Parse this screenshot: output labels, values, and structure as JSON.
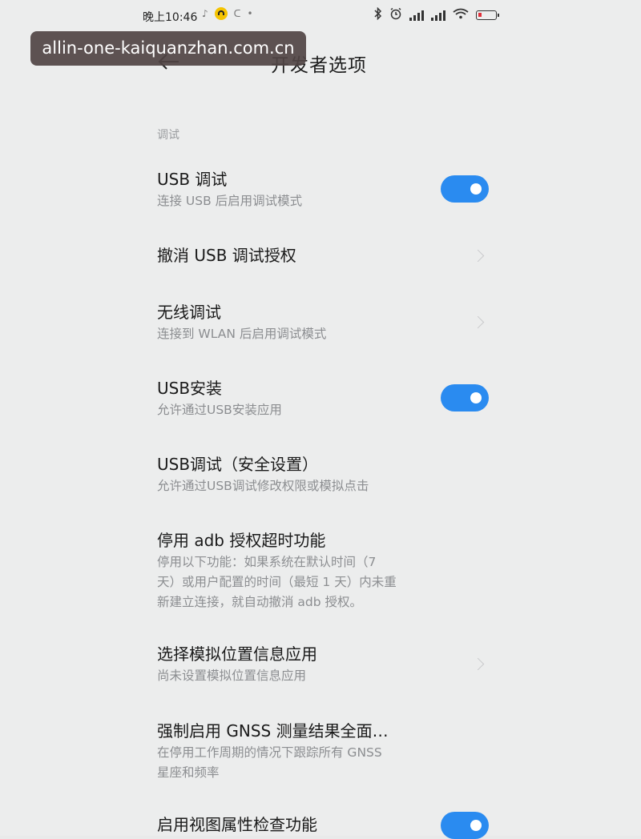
{
  "status_bar": {
    "time": "晚上10:46",
    "left_icons": [
      "mute-icon",
      "app-notification-icon",
      "search-icon",
      "dot-icon"
    ],
    "right_icons": [
      "bluetooth-icon",
      "alarm-icon",
      "signal-icon",
      "signal-hd-icon",
      "wifi-icon",
      "battery-icon"
    ],
    "battery_level": "9"
  },
  "watermark": {
    "text": "allin-one-kaiquanzhan.com.cn"
  },
  "header": {
    "back_icon": "back-arrow-icon",
    "title": "开发者选项"
  },
  "section": {
    "label": "调试"
  },
  "settings": [
    {
      "title": "USB 调试",
      "subtitle": "连接 USB 后启用调试模式",
      "control": "toggle",
      "state": "on"
    },
    {
      "title": "撤消 USB 调试授权",
      "subtitle": "",
      "control": "chevron"
    },
    {
      "title": "无线调试",
      "subtitle": "连接到 WLAN 后启用调试模式",
      "control": "chevron"
    },
    {
      "title": "USB安装",
      "subtitle": "允许通过USB安装应用",
      "control": "toggle",
      "state": "on"
    },
    {
      "title": "USB调试（安全设置）",
      "subtitle": "允许通过USB调试修改权限或模拟点击",
      "control": "none"
    },
    {
      "title": "停用 adb 授权超时功能",
      "subtitle_lines": [
        "停用以下功能：如果系统在默认时间（7",
        "天）或用户配置的时间（最短 1 天）内未重",
        "新建立连接，就自动撤消 adb 授权。"
      ],
      "control": "none"
    },
    {
      "title": "选择模拟位置信息应用",
      "subtitle": "尚未设置模拟位置信息应用",
      "control": "chevron"
    },
    {
      "title": "强制启用 GNSS 测量结果全面…",
      "subtitle_lines": [
        "在停用工作周期的情况下跟踪所有 GNSS",
        "星座和频率"
      ],
      "control": "none"
    },
    {
      "title": "启用视图属性检查功能",
      "subtitle": "",
      "control": "toggle",
      "state": "on"
    }
  ],
  "colors": {
    "background": "#eceded",
    "accent": "#2a8bf0",
    "subtitle": "#8c8e91",
    "section_label": "#9a9c9f"
  }
}
